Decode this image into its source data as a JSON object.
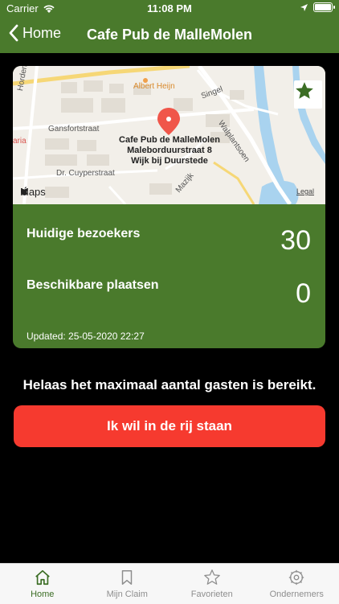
{
  "status_bar": {
    "carrier": "Carrier",
    "time": "11:08 PM"
  },
  "nav": {
    "back_label": "Home",
    "title": "Cafe Pub de MalleMolen"
  },
  "map": {
    "pin_label_lines": [
      "Cafe Pub de MalleMolen",
      "Maleborduurstraat 8",
      "Wijk bij Duurstede"
    ],
    "streets": {
      "albert_heijn": "Albert Heijn",
      "hordenwg": "Hordenwg",
      "gansfortstraat": "Gansfortstraat",
      "singel": "Singel",
      "waipiantsoen": "Walplantsoen",
      "dr_cuyperstraat": "Dr. Cuyperstraat",
      "mazijk": "Mazijk",
      "aria": "aria"
    },
    "maps_brand": "Maps",
    "legal": "Legal"
  },
  "stats": {
    "visitors_label": "Huidige bezoekers",
    "visitors_value": "30",
    "available_label": "Beschikbare plaatsen",
    "available_value": "0",
    "updated": "Updated: 25-05-2020 22:27"
  },
  "message": "Helaas het maximaal aantal gasten is bereikt.",
  "queue_button": "Ik wil in de rij staan",
  "tabs": [
    {
      "label": "Home",
      "icon": "house-icon",
      "active": true
    },
    {
      "label": "Mijn Claim",
      "icon": "bookmark-icon",
      "active": false
    },
    {
      "label": "Favorieten",
      "icon": "star-icon",
      "active": false
    },
    {
      "label": "Ondernemers",
      "icon": "gear-icon",
      "active": false
    }
  ],
  "colors": {
    "brand_green": "#4a7a2c",
    "action_red": "#f63a2f",
    "tab_active": "#3b6d24"
  }
}
